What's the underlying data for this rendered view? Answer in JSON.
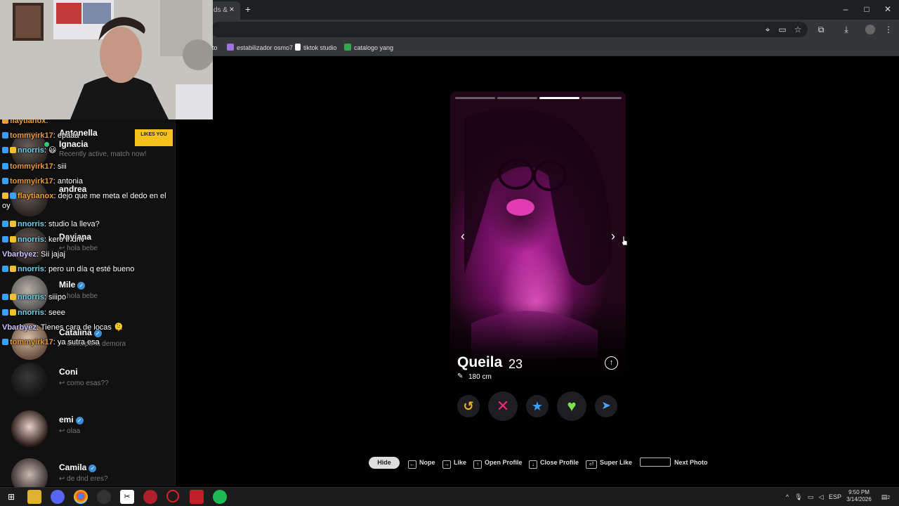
{
  "browser": {
    "tab_title": "ds &",
    "tab_close_icon": "×",
    "new_tab_icon": "+",
    "window_controls": [
      "–",
      "□",
      "✕"
    ],
    "bookmarks": [
      {
        "label": "to",
        "color": "#888888"
      },
      {
        "label": "estabilizador osmo7",
        "color": "#a070e0"
      },
      {
        "label": "tiktok studio",
        "color": "#222222"
      },
      {
        "label": "catalogo yang",
        "color": "#2ea84a"
      }
    ]
  },
  "sidebar": {
    "likes_badge": "LIKES YOU",
    "matches": [
      {
        "name": "Antonella",
        "msg": ""
      },
      {
        "name": "Ignacia",
        "msg": "Recently active, match now!"
      },
      {
        "name": "andrea",
        "msg": ""
      },
      {
        "name": "Dayiana",
        "msg": "↩ hola bebe"
      },
      {
        "name": "Mile",
        "msg": "↩ hola bebe",
        "verified": true
      },
      {
        "name": "Catalina",
        "msg": "↩ disculpa la demora",
        "verified": true
      },
      {
        "name": "Coni",
        "msg": "↩ como esas??"
      },
      {
        "name": "emi",
        "msg": "↩ olaa",
        "verified": true
      },
      {
        "name": "Camila",
        "msg": "↩ de dnd eres?",
        "verified": true
      }
    ]
  },
  "chat": {
    "lines": [
      {
        "user": "flaytianox",
        "text": ":",
        "color": "#f0a030"
      },
      {
        "user": "tommyirk17",
        "text": ": epaaa",
        "color": "#e89a3a"
      },
      {
        "user": "nnorris",
        "text": ": 😃",
        "color": "#6fd3f0"
      },
      {
        "user": "tommyirk17",
        "text": ": siii",
        "color": "#e89a3a"
      },
      {
        "user": "tommyirk17",
        "text": ": antonia",
        "color": "#e89a3a"
      },
      {
        "user": "flaytianox",
        "text": ": dejo que me meta el dedo en el oy",
        "color": "#f0a030"
      },
      {
        "user": "nnorris",
        "text": ": studio la lleva?",
        "color": "#6fd3f0"
      },
      {
        "user": "nnorris",
        "text": ": kero ir dnv",
        "color": "#6fd3f0"
      },
      {
        "user": "Vbarbyez",
        "text": ": Sii jajaj",
        "color": "#c9c3ff"
      },
      {
        "user": "nnorris",
        "text": ": pero un día q esté bueno",
        "color": "#6fd3f0"
      },
      {
        "user": "nnorris",
        "text": ": siiipo",
        "color": "#6fd3f0"
      },
      {
        "user": "nnorris",
        "text": ": seee",
        "color": "#6fd3f0"
      },
      {
        "user": "Vbarbyez",
        "text": ": Tienes cara de locas 🫠",
        "color": "#c9c3ff"
      },
      {
        "user": "tommyirk17",
        "text": ": ya sutra esa",
        "color": "#e89a3a"
      }
    ]
  },
  "card": {
    "photo_count": 4,
    "active_photo": 3,
    "name": "Queila",
    "age": "23",
    "height": "180 cm",
    "prev_icon": "‹",
    "next_icon": "›",
    "expand_icon": "↑",
    "actions": [
      {
        "name": "rewind-button",
        "icon": "↺",
        "color": "#f2b21b"
      },
      {
        "name": "nope-button",
        "icon": "✕",
        "color": "#fd267d"
      },
      {
        "name": "super-like-button",
        "icon": "★",
        "color": "#3aa0ff"
      },
      {
        "name": "like-button",
        "icon": "♥",
        "color": "#7be34b"
      },
      {
        "name": "boost-button",
        "icon": "➤",
        "color": "#4aa3ff"
      }
    ]
  },
  "shortcuts": {
    "hide": "Hide",
    "items": [
      {
        "key": "←",
        "label": "Nope"
      },
      {
        "key": "→",
        "label": "Like"
      },
      {
        "key": "↑",
        "label": "Open Profile"
      },
      {
        "key": "↓",
        "label": "Close Profile"
      },
      {
        "key": "⏎",
        "label": "Super Like"
      },
      {
        "key": "",
        "label": "Next Photo"
      }
    ]
  },
  "taskbar": {
    "lang": "ESP",
    "time": "9:50 PM",
    "date": "3/14/2026",
    "notifications": "2"
  }
}
